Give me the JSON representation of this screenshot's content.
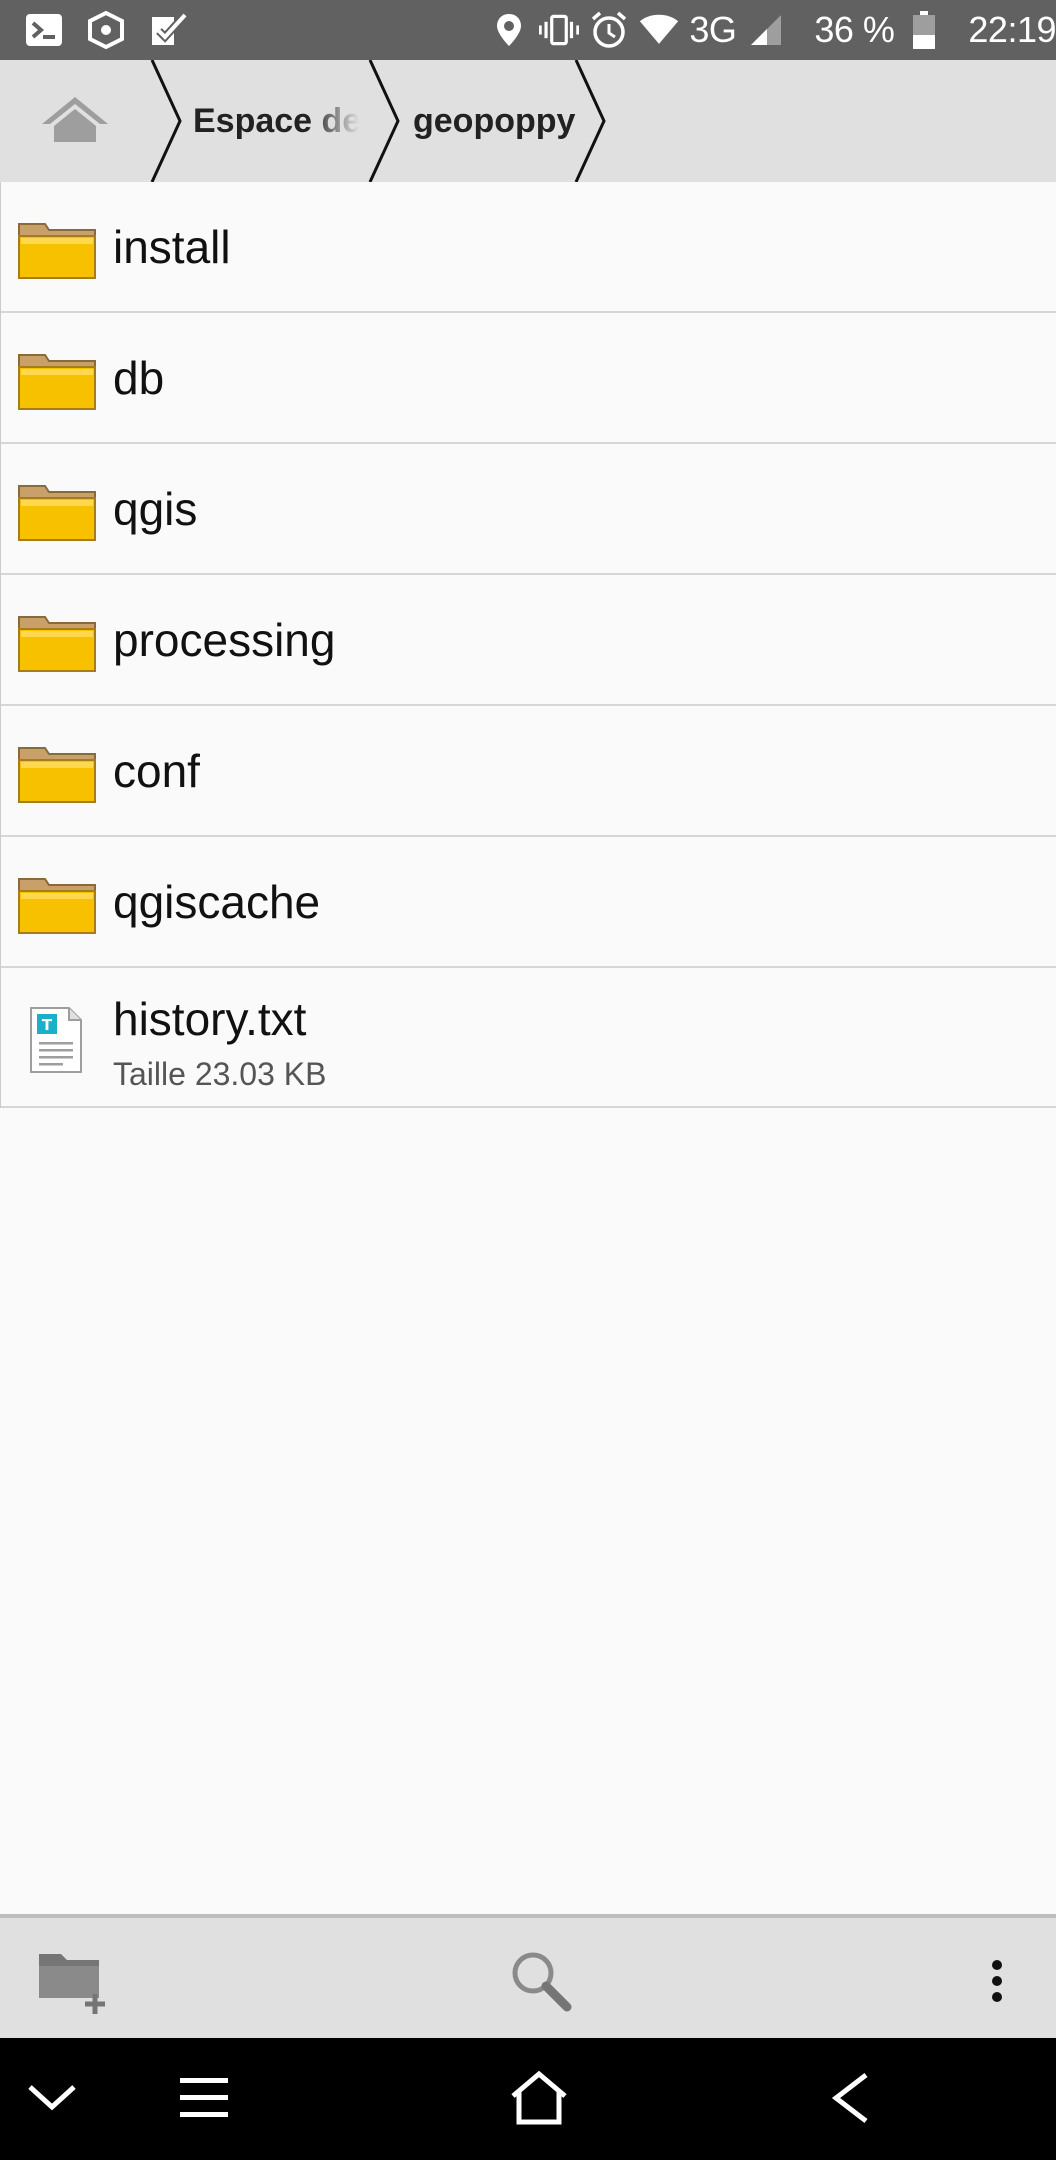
{
  "status_bar": {
    "network": "3G",
    "battery": "36 %",
    "time": "22:19",
    "icons_left": [
      "terminal-icon",
      "shield-icon",
      "checklist-icon"
    ],
    "icons_right": [
      "location-icon",
      "vibrate-icon",
      "alarm-icon",
      "wifi-icon",
      "signal-icon",
      "battery-icon"
    ]
  },
  "breadcrumb": {
    "home_icon": "home-icon",
    "items": [
      {
        "label": "Espace de"
      },
      {
        "label": "geopoppy"
      }
    ]
  },
  "files": [
    {
      "name": "install",
      "type": "folder"
    },
    {
      "name": "db",
      "type": "folder"
    },
    {
      "name": "qgis",
      "type": "folder"
    },
    {
      "name": "processing",
      "type": "folder"
    },
    {
      "name": "conf",
      "type": "folder"
    },
    {
      "name": "qgiscache",
      "type": "folder"
    },
    {
      "name": "history.txt",
      "type": "file",
      "meta": "Taille 23.03 KB"
    }
  ],
  "toolbar": {
    "icons": [
      "new-folder-icon",
      "search-icon",
      "more-options-icon"
    ]
  },
  "navbar": {
    "icons": [
      "collapse-icon",
      "menu-icon",
      "home-icon",
      "back-icon"
    ]
  },
  "colors": {
    "status_bar": "#616161",
    "breadcrumb_bg": "#e0e0e0",
    "list_bg": "#fafafa",
    "folder_yellow": "#f7c100",
    "folder_tab": "#c9a06a",
    "navbar": "#000000"
  }
}
